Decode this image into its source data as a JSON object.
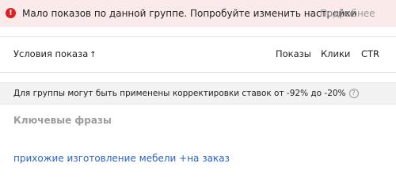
{
  "alert": {
    "icon": "exclamation-icon",
    "message": "Мало показов по данной группе. Попробуйте изменить настройки",
    "link": "Подробнее"
  },
  "table_header": {
    "columns": [
      "Условия показа",
      "Показы",
      "Клики",
      "CTR"
    ],
    "sort_indicator": "↑"
  },
  "notice": {
    "text": "Для группы могут быть применены корректировки ставок от -92% до -20%",
    "help_symbol": "?"
  },
  "section": {
    "title": "Ключевые фразы"
  },
  "phrases": [
    {
      "text": "прихожие изготовление мебели +на заказ",
      "more": "···"
    }
  ],
  "colors": {
    "alert_bg": "#fbeaea",
    "alert_icon": "#e01f1f",
    "link_blue": "#2b62c8"
  }
}
